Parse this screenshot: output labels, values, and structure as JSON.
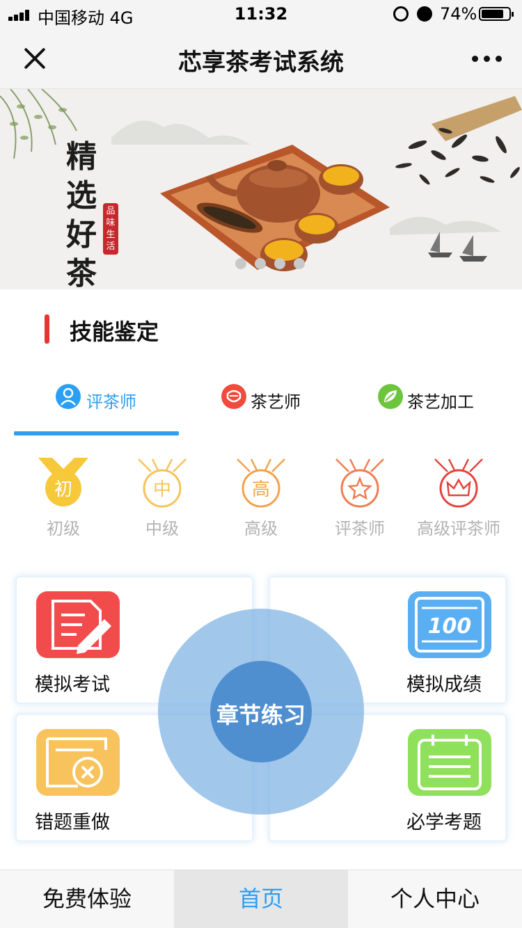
{
  "status_bar": {
    "carrier": "中国移动  4G",
    "time": "11:32",
    "battery": "74%"
  },
  "nav": {
    "title": "芯享茶考试系统"
  },
  "banner": {
    "calligraphy": [
      "精",
      "选",
      "好",
      "茶"
    ],
    "seal": [
      "品",
      "味",
      "生",
      "活"
    ],
    "slide_count": 4,
    "active_slide": 0
  },
  "section": {
    "title": "技能鉴定"
  },
  "tabs": [
    {
      "label": "评茶师",
      "icon": "person-icon",
      "color": "#2a9ff4",
      "active": true
    },
    {
      "label": "茶艺师",
      "icon": "mask-icon",
      "color": "#f04b3c",
      "active": false
    },
    {
      "label": "茶艺加工",
      "icon": "leaf-icon",
      "color": "#6cc53d",
      "active": false
    }
  ],
  "levels": [
    {
      "label": "初级",
      "glyph": "初",
      "icon": "medal-primary-icon",
      "color": "#f6c83a"
    },
    {
      "label": "中级",
      "glyph": "中",
      "icon": "medal-intermediate-icon",
      "color": "#f6c35a"
    },
    {
      "label": "高级",
      "glyph": "高",
      "icon": "medal-advanced-icon",
      "color": "#f2a24a"
    },
    {
      "label": "评茶师",
      "glyph": "",
      "icon": "medal-star-icon",
      "color": "#ee7d52"
    },
    {
      "label": "高级评茶师",
      "glyph": "",
      "icon": "medal-crown-icon",
      "color": "#e4433c"
    }
  ],
  "cards": {
    "mock_exam": {
      "label": "模拟考试",
      "icon": "edit-document-icon",
      "color": "#f24b4b"
    },
    "mock_score": {
      "label": "模拟成绩",
      "icon": "score-100-icon",
      "color": "#5aaef2",
      "score": "100"
    },
    "redo_wrong": {
      "label": "错题重做",
      "icon": "wrong-answer-icon",
      "color": "#f8c25c"
    },
    "must_learn": {
      "label": "必学考题",
      "icon": "notebook-icon",
      "color": "#8fe05a"
    }
  },
  "center_button": {
    "label": "章节练习"
  },
  "bottom_tabs": [
    {
      "label": "免费体验",
      "active": false
    },
    {
      "label": "首页",
      "active": true
    },
    {
      "label": "个人中心",
      "active": false
    }
  ]
}
